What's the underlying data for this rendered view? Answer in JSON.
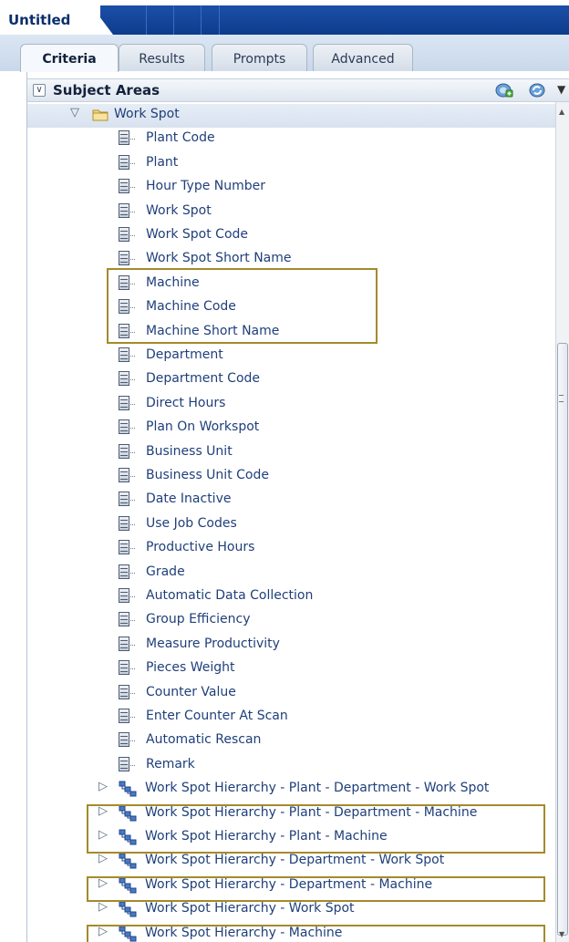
{
  "window": {
    "title": "Untitled"
  },
  "tabs": [
    {
      "label": "Criteria",
      "active": true
    },
    {
      "label": "Results",
      "active": false
    },
    {
      "label": "Prompts",
      "active": false
    },
    {
      "label": "Advanced",
      "active": false
    }
  ],
  "panel": {
    "title": "Subject Areas",
    "collapse_icon": "chevron-down-icon",
    "actions": [
      "add-subject-area-icon",
      "refresh-icon"
    ],
    "dropdown_icon": "chevron-down-icon"
  },
  "folder": {
    "label": "Work Spot",
    "expanded": true
  },
  "columns": [
    "Plant Code",
    "Plant",
    "Hour Type Number",
    "Work Spot",
    "Work Spot Code",
    "Work Spot Short Name",
    "Machine",
    "Machine Code",
    "Machine Short Name",
    "Department",
    "Department Code",
    "Direct Hours",
    "Plan On Workspot",
    "Business Unit",
    "Business Unit Code",
    "Date Inactive",
    "Use Job Codes",
    "Productive Hours",
    "Grade",
    "Automatic Data Collection",
    "Group Efficiency",
    "Measure Productivity",
    "Pieces Weight",
    "Counter Value",
    "Enter Counter At Scan",
    "Automatic Rescan",
    "Remark"
  ],
  "hierarchies": [
    "Work Spot Hierarchy - Plant - Department - Work Spot",
    "Work Spot Hierarchy - Plant - Department - Machine",
    "Work Spot Hierarchy - Plant - Machine",
    "Work Spot Hierarchy - Department - Work Spot",
    "Work Spot Hierarchy - Department - Machine",
    "Work Spot Hierarchy - Work Spot",
    "Work Spot Hierarchy - Machine"
  ],
  "colors": {
    "highlight_border": "#a48a2c",
    "link_text": "#1f3f7a",
    "title_bar": "#0e3c8c"
  }
}
